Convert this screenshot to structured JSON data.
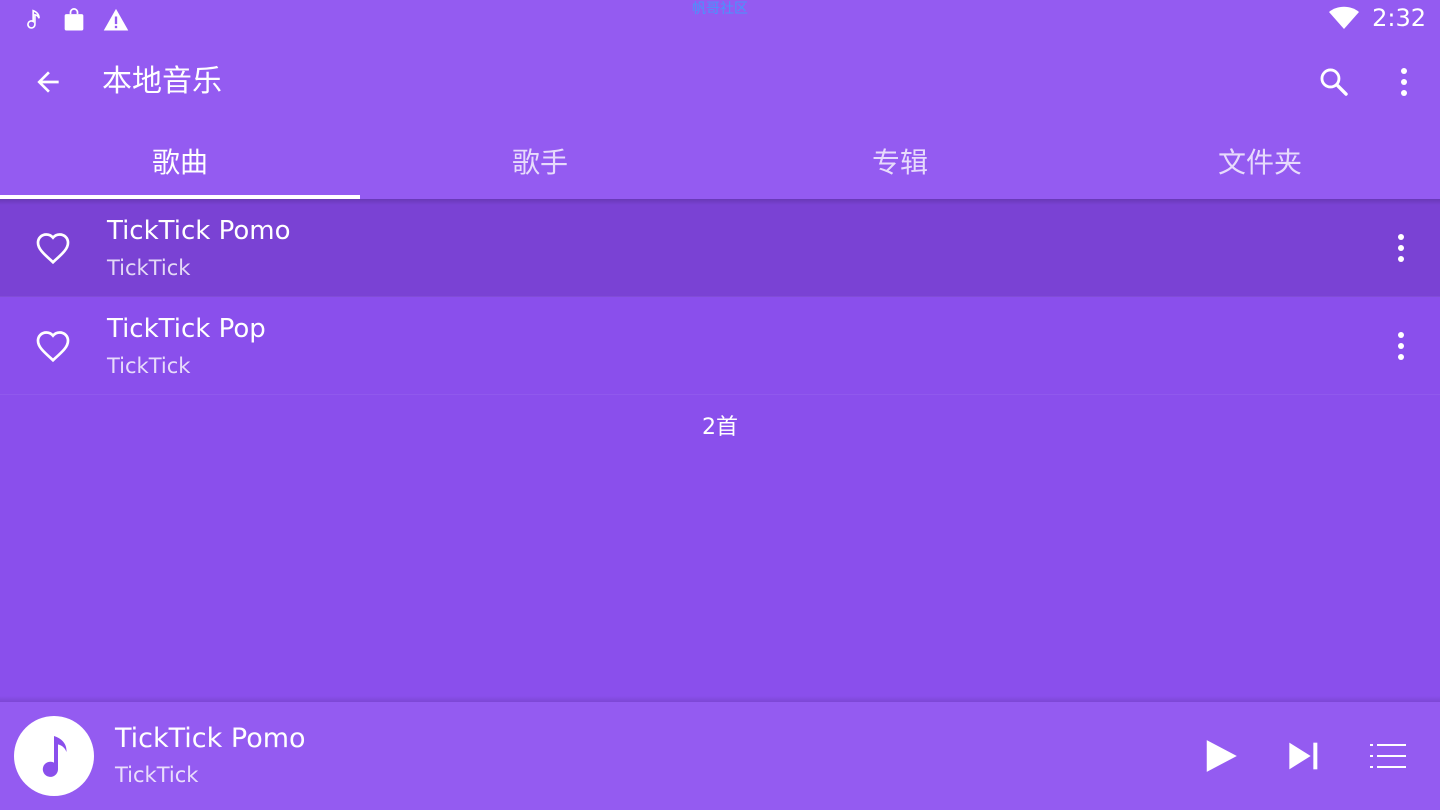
{
  "colors": {
    "primary": "#945bf1",
    "background": "#8a4fec",
    "selected_row": "#7a42d4",
    "accent": "#ffffff"
  },
  "status_bar": {
    "icons": [
      "music-note-icon",
      "shopping-bag-icon",
      "warning-icon"
    ],
    "watermark": "帆哥社区",
    "time": "2:32",
    "wifi_icon": "wifi-icon"
  },
  "app_bar": {
    "title": "本地音乐",
    "back_icon": "arrow-back-icon",
    "search_icon": "search-icon",
    "more_icon": "more-vert-icon"
  },
  "tabs": [
    {
      "label": "歌曲",
      "active": true
    },
    {
      "label": "歌手",
      "active": false
    },
    {
      "label": "专辑",
      "active": false
    },
    {
      "label": "文件夹",
      "active": false
    }
  ],
  "songs": [
    {
      "title": "TickTick Pomo",
      "artist": "TickTick",
      "selected": true
    },
    {
      "title": "TickTick Pop",
      "artist": "TickTick",
      "selected": false
    }
  ],
  "song_count": "2首",
  "now_playing": {
    "title": "TickTick Pomo",
    "artist": "TickTick",
    "art_icon": "music-note-icon",
    "controls": [
      "play-icon",
      "skip-next-icon",
      "queue-list-icon"
    ]
  }
}
